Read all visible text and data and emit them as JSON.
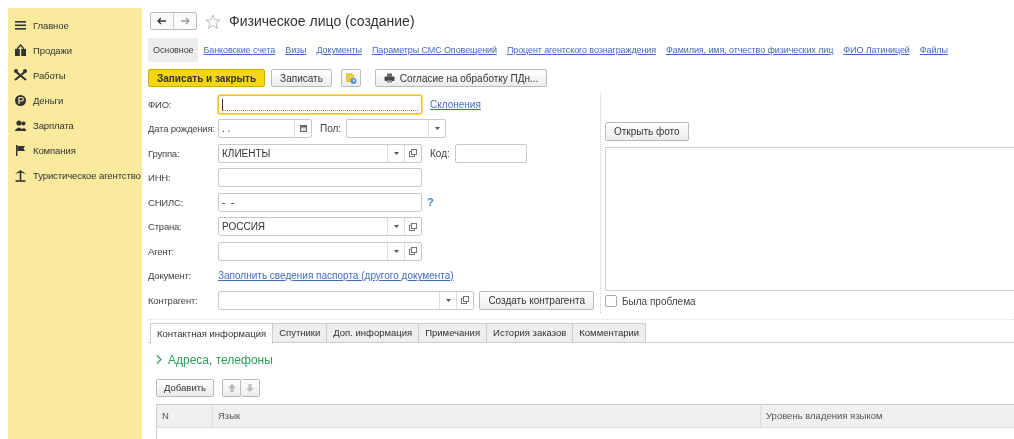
{
  "sidebar": {
    "items": [
      {
        "label": "Главное"
      },
      {
        "label": "Продажи"
      },
      {
        "label": "Работы"
      },
      {
        "label": "Деньги"
      },
      {
        "label": "Зарплата"
      },
      {
        "label": "Компания"
      },
      {
        "label": "Туристическое агентство"
      }
    ]
  },
  "window": {
    "title": "Физическое лицо (создание)"
  },
  "nav_links": [
    {
      "label": "Основное",
      "selected": true
    },
    {
      "label": "Банковские счета",
      "selected": false
    },
    {
      "label": "Визы",
      "selected": false
    },
    {
      "label": "Документы",
      "selected": false
    },
    {
      "label": "Параметры СМС Оповещений",
      "selected": false
    },
    {
      "label": "Процент агентского вознаграждения",
      "selected": false
    },
    {
      "label": "Фамилия, имя, отчество физических лиц",
      "selected": false
    },
    {
      "label": "ФИО Латиницей",
      "selected": false
    },
    {
      "label": "Файлы",
      "selected": false
    }
  ],
  "toolbar": {
    "buttons": [
      {
        "kind": "primary",
        "label": "Записать и закрыть"
      },
      {
        "kind": "plain",
        "label": "Записать"
      },
      {
        "kind": "icon"
      },
      {
        "kind": "print",
        "label": "Согласие на обработку ПДн..."
      }
    ]
  },
  "form": {
    "rows": [
      [
        {
          "kind": "text",
          "label": "ФИО:",
          "focused": true
        },
        {
          "kind": "link",
          "text": "Склонения"
        }
      ],
      [
        {
          "kind": "date",
          "label": "Дата рождения:",
          "value": ". .",
          "focused": false
        },
        {
          "kind": "select",
          "label": "Пол:",
          "focused": false
        }
      ],
      [
        {
          "kind": "combo",
          "label": "Группа:",
          "value": "КЛИЕНТЫ",
          "focused": false
        },
        {
          "kind": "text",
          "label": "Код:",
          "focused": false
        }
      ],
      [
        {
          "kind": "text",
          "label": "ИНН:",
          "focused": false
        }
      ],
      [
        {
          "kind": "text",
          "label": "СНИЛС:",
          "value": "-  -",
          "focused": false
        },
        {
          "kind": "help",
          "text": "?"
        }
      ],
      [
        {
          "kind": "combo",
          "label": "Страна:",
          "value": "РОССИЯ",
          "focused": false
        }
      ],
      [
        {
          "kind": "combo",
          "label": "Агент:",
          "focused": false
        }
      ],
      [
        {
          "kind": "link",
          "label": "Документ:",
          "text": "Заполнить сведения паспорта (другого документа)"
        }
      ],
      [
        {
          "kind": "combo",
          "label": "Контрагент:",
          "focused": false
        },
        {
          "kind": "button",
          "text": "Создать контрагента"
        }
      ]
    ]
  },
  "photo": {
    "button": "Открыть фото",
    "checkbox": {
      "label": "Была проблема",
      "checked": false
    }
  },
  "tabs": [
    {
      "label": "Контактная информация",
      "selected": true
    },
    {
      "label": "Спутники",
      "selected": false
    },
    {
      "label": "Доп. информация",
      "selected": false
    },
    {
      "label": "Примечания",
      "selected": false
    },
    {
      "label": "История заказов",
      "selected": false
    },
    {
      "label": "Комментарии",
      "selected": false
    }
  ],
  "group": {
    "title": "Адреса, телефоны",
    "expanded": false
  },
  "table_toolbar": {
    "buttons": [
      {
        "kind": "text",
        "label": "Добавить",
        "disabled": false
      },
      {
        "kind": "up",
        "disabled": true
      },
      {
        "kind": "down",
        "disabled": true
      }
    ]
  },
  "table": {
    "columns": [
      "N",
      "Язык",
      "Уровень владения языком"
    ]
  }
}
